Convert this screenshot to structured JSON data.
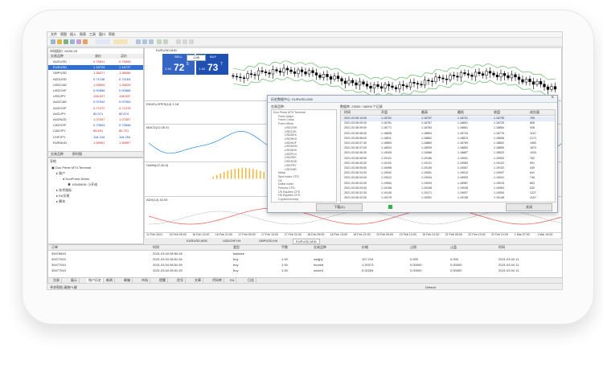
{
  "menu": {
    "items": [
      "文件",
      "视图",
      "插入",
      "图表",
      "工具",
      "窗口",
      "帮助"
    ]
  },
  "chart_tab_title": "EURUSD,M30",
  "market_watch": {
    "title": "市场报价: 08:50:28",
    "columns": [
      "交易品种",
      "卖价",
      "买价"
    ],
    "rows": [
      {
        "symbol": "AUDUSD",
        "bid": "0.75641",
        "ask": "0.75658"
      },
      {
        "symbol": "EURUSD",
        "bid": "1.18725",
        "ask": "1.18737"
      },
      {
        "symbol": "GBPUSD",
        "bid": "1.38077",
        "ask": "1.38086"
      },
      {
        "symbol": "NZDUSD",
        "bid": "0.71138",
        "ask": "0.71163"
      },
      {
        "symbol": "USDCAD",
        "bid": "1.26605",
        "ask": "1.26626"
      },
      {
        "symbol": "USDCHF",
        "bid": "0.92856",
        "ask": "0.92866"
      },
      {
        "symbol": "USDJPY",
        "bid": "108.527",
        "ask": "108.537"
      },
      {
        "symbol": "AUDCAD",
        "bid": "0.97042",
        "ask": "0.97053"
      },
      {
        "symbol": "AUDCHF",
        "bid": "0.71372",
        "ask": "0.71376"
      },
      {
        "symbol": "AUDJPY",
        "bid": "82.071",
        "ask": "82.074"
      },
      {
        "symbol": "AUDNZD",
        "bid": "1.07047",
        "ask": "1.07057"
      },
      {
        "symbol": "CADCHF",
        "bid": "0.73543",
        "ask": "0.73548"
      },
      {
        "symbol": "CADJPY",
        "bid": "85.691",
        "ask": "85.701"
      },
      {
        "symbol": "CHFJPY",
        "bid": "116.244",
        "ask": "116.254"
      },
      {
        "symbol": "EURAUD",
        "bid": "1.55991",
        "ask": "1.55997"
      }
    ],
    "tabs": [
      "交易品种",
      "即时图"
    ]
  },
  "navigator": {
    "title": "导航",
    "items": [
      "Doo Prime MT4 Terminal",
      "账户",
      "DooPrime-Demo",
      "19040605: 小开成",
      "技术指标",
      "EA交易",
      "脚本"
    ],
    "tabs": [
      "常用",
      "收藏夹"
    ]
  },
  "trade_panel": {
    "symbol": "EURUSD,M30",
    "sell_label": "SELL",
    "buy_label": "BUY",
    "lot": "1.00",
    "sell_price_small": "1.18",
    "sell_price_big": "72",
    "sell_price_sup": "5",
    "buy_price_small": "1.18",
    "buy_price_big": "73",
    "buy_price_sup": "7"
  },
  "indicators": {
    "top": "ENVELOPES(14) 1.18",
    "macd": "MACD(12,26,9)",
    "osma": "OsMA(12,26,9)",
    "adx": "ADX(14) 42.09"
  },
  "time_axis": [
    "12 Feb 2021",
    "16 Feb 05:00",
    "16 Feb 13:00",
    "16 Feb 21:00",
    "17 Feb 05:00",
    "17 Feb 13:00",
    "17 Feb 21:00",
    "18 Feb 05:00",
    "18 Feb 13:00",
    "18 Feb 21:00",
    "19 Feb 05:00",
    "19 Feb 13:00",
    "19 Feb 21:00",
    "22 Feb 05:00",
    "22 Feb 13:00",
    "22 Feb 21:00",
    "1 Mar 07:00",
    "1 Mar 16:00"
  ],
  "chart_tabs": [
    "EURUSD,M30",
    "USDCHF,H4",
    "GBPUSD,H4",
    "EURUSD,M30"
  ],
  "history_dialog": {
    "title": "历史数据中心: EURUSD,M30",
    "tree_header": "交易品种:",
    "tree": [
      "Doo Prime MT4 Terminal",
      "Forex Major",
      "Forex Cross",
      "Forex Minor",
      "USDCNH",
      "USDCZK",
      "USDDKK",
      "USDHKD",
      "USDHUF",
      "USDMXN",
      "USDNOK",
      "USDPLN",
      "USDSEK",
      "USDSGD",
      "USDTRY",
      "USDZAR",
      "Metal",
      "Spot Index CFD",
      "Oil",
      "Dollar Index",
      "Futures CFD",
      "US Equities CFD",
      "HK Equities CFD",
      "CryptoCurrency"
    ],
    "db_label": "数据库: 23000 / 38309 个记录",
    "columns": [
      "时间",
      "开盘",
      "最高",
      "最低",
      "收盘",
      "成交量"
    ],
    "rows": [
      [
        "2021.03.08 10:00",
        "1.18751",
        "1.18757",
        "1.18721",
        "1.18735",
        "765"
      ],
      [
        "2021.03.08 09:30",
        "1.18781",
        "1.18787",
        "1.18651",
        "1.18726",
        "665"
      ],
      [
        "2021.03.08 09:00",
        "1.18771",
        "1.18784",
        "1.18661",
        "1.18684",
        "938"
      ],
      [
        "2021.03.08 08:30",
        "1.18838",
        "1.18854",
        "1.18744",
        "1.18776",
        "1110"
      ],
      [
        "2021.03.08 08:00",
        "1.18811",
        "1.18862",
        "1.18813",
        "1.18836",
        "2171"
      ],
      [
        "2021.03.08 07:30",
        "1.18853",
        "1.18869",
        "1.18789",
        "1.18802",
        "1963"
      ],
      [
        "2021.03.08 07:00",
        "1.18924",
        "1.18939",
        "1.18852",
        "1.18855",
        "1873"
      ],
      [
        "2021.03.08 06:30",
        "1.19005",
        "1.19066",
        "1.18887",
        "1.18920",
        "1033"
      ],
      [
        "2021.03.08 06:00",
        "1.19121",
        "1.19186",
        "1.19001",
        "1.19000",
        "782"
      ],
      [
        "2021.03.08 05:30",
        "1.19102",
        "1.19131",
        "1.19083",
        "1.19122",
        "901"
      ],
      [
        "2021.03.08 05:00",
        "1.19098",
        "1.19106",
        "1.19087",
        "1.19102",
        "439"
      ],
      [
        "2021.03.08 04:30",
        "1.19042",
        "1.19081",
        "1.19010",
        "1.19097",
        "641"
      ],
      [
        "2021.03.08 04:00",
        "1.19012",
        "1.19044",
        "1.18993",
        "1.19041",
        "746"
      ],
      [
        "2021.03.08 03:30",
        "1.19064",
        "1.19094",
        "1.18987",
        "1.19015",
        "893"
      ],
      [
        "2021.03.08 03:00",
        "1.19108",
        "1.19108",
        "1.19045",
        "1.19063",
        "632"
      ],
      [
        "2021.03.08 02:30",
        "1.19145",
        "1.19171",
        "1.19007",
        "1.19054",
        "1227"
      ],
      [
        "2021.03.08 02:00",
        "1.19275",
        "1.19281",
        "1.19138",
        "1.19146",
        "1110"
      ]
    ],
    "download_label": "下载(D)",
    "close_label": "关闭"
  },
  "terminal": {
    "columns": [
      "订单",
      "时间",
      "类型",
      "手数",
      "交易品种",
      "价格",
      "止损",
      "止盈",
      "时间"
    ],
    "rows": [
      [
        "39476843",
        "2021.03.04 08:50:28",
        "balance",
        "",
        "",
        "",
        "",
        "",
        ""
      ],
      [
        "39477020",
        "2021.03.04 08:51:34",
        "buy",
        "1.00",
        "usdjpy",
        "107.214",
        "0.000",
        "0.000",
        "2021.03.04 11"
      ],
      [
        "39477044",
        "2021.03.04 08:51:39",
        "buy",
        "1.00",
        "eurusd",
        "1.20373",
        "0.00000",
        "0.00000",
        "2021.03.04 11"
      ],
      [
        "39477043",
        "2021.03.04 08:51:39",
        "buy",
        "1.00",
        "usdchf",
        "0.92254",
        "0.00000",
        "0.00000",
        "2021.03.04 11"
      ]
    ],
    "tabs": [
      "交易",
      "展示",
      "账户历史",
      "新闻",
      "邮箱",
      "市场",
      "提醒",
      "信号",
      "文章",
      "代码库",
      "EA",
      "日志"
    ]
  },
  "status": {
    "help": "寻求帮助,请按F1键",
    "profile": "Default"
  },
  "colors": {
    "up_candle": "#ffffff",
    "down_candle": "#000000",
    "envelope": "#4caf50",
    "macd": "#1e88e5",
    "osma": "#f0b429",
    "adx": "#ef5350",
    "sell": "#3565c4",
    "buy": "#1f4fb0"
  }
}
